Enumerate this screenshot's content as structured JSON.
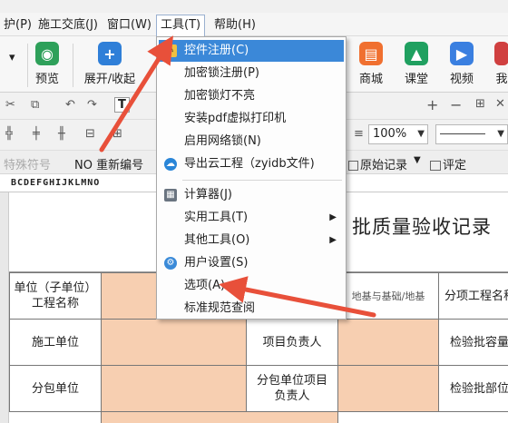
{
  "menubar": {
    "items": [
      "护(P)",
      "施工交底(J)",
      "窗口(W)",
      "工具(T)",
      "帮助(H)"
    ],
    "active_index": 3
  },
  "ribbon": {
    "buttons": [
      {
        "label": "预览",
        "icon": "preview-icon",
        "color": "#2ea05a"
      },
      {
        "label": "展开/收起",
        "icon": "expand-plus-icon",
        "color": "#2f7fd8"
      },
      {
        "label": "商城",
        "icon": "shop-icon",
        "color": "#f07030"
      },
      {
        "label": "课堂",
        "icon": "classroom-icon",
        "color": "#20a060"
      },
      {
        "label": "视频",
        "icon": "video-icon",
        "color": "#3a7fe0"
      },
      {
        "label": "我",
        "icon": "user-icon",
        "color": "#d04040"
      }
    ]
  },
  "toolbar": {
    "zoom": "100%",
    "record_label": "NO 重新编号",
    "original_record": "原始记录",
    "evaluate": "评定",
    "strike_label": "特殊符号"
  },
  "ruler": "BCDEFGHIJKLMNO",
  "tools_menu": {
    "items": [
      {
        "label": "控件注册(C)",
        "icon": "register-control-icon",
        "highlighted": true
      },
      {
        "label": "加密锁注册(P)"
      },
      {
        "label": "加密锁灯不亮"
      },
      {
        "label": "安装pdf虚拟打印机"
      },
      {
        "label": "启用网络锁(N)"
      },
      {
        "label": "导出云工程（zyidb文件)",
        "icon": "cloud-export-icon"
      },
      {
        "label": "计算器(J)",
        "icon": "calculator-icon"
      },
      {
        "label": "实用工具(T)",
        "submenu": true
      },
      {
        "label": "其他工具(O)",
        "submenu": true
      },
      {
        "label": "用户设置(S)",
        "icon": "gear-icon"
      },
      {
        "label": "选项(A)"
      },
      {
        "label": "标准规范查阅"
      }
    ]
  },
  "document": {
    "title": "批质量验收记录",
    "cells": {
      "unit_name": "单位（子单位）工程名称",
      "sub_project_value": "地基与基础/地基",
      "sub_project_name": "分项工程名称",
      "construction_unit": "施工单位",
      "project_manager": "项目负责人",
      "inspection_capacity": "检验批容量",
      "subcontractor": "分包单位",
      "sub_project_manager": "分包单位项目负责人",
      "inspection_part": "检验批部位"
    }
  },
  "colors": {
    "highlight": "#3b88d8",
    "arrow": "#e8503a",
    "peach_cell": "#f7cfb1"
  }
}
